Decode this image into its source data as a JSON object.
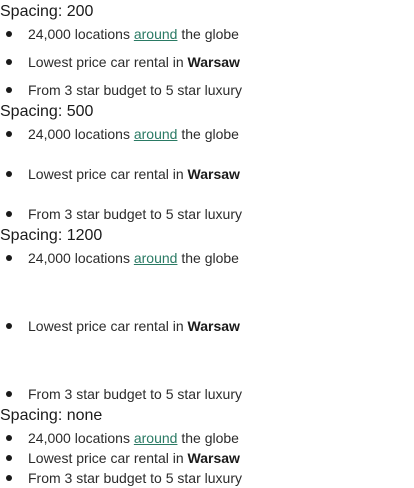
{
  "sections": [
    {
      "heading": "Spacing: 200",
      "items": [
        {
          "pre": "24,000 locations ",
          "link": "around",
          "post": " the globe"
        },
        {
          "pre": "Lowest price car rental in ",
          "bold": "Warsaw"
        },
        {
          "pre": "From 3 star budget to 5 star luxury"
        }
      ]
    },
    {
      "heading": "Spacing: 500",
      "items": [
        {
          "pre": "24,000 locations ",
          "link": "around",
          "post": " the globe"
        },
        {
          "pre": "Lowest price car rental in ",
          "bold": "Warsaw"
        },
        {
          "pre": "From 3 star budget to 5 star luxury"
        }
      ]
    },
    {
      "heading": "Spacing: 1200",
      "items": [
        {
          "pre": "24,000 locations ",
          "link": "around",
          "post": " the globe"
        },
        {
          "pre": "Lowest price car rental in ",
          "bold": "Warsaw"
        },
        {
          "pre": "From 3 star budget to 5 star luxury"
        }
      ]
    },
    {
      "heading": "Spacing: none",
      "items": [
        {
          "pre": "24,000 locations ",
          "link": "around",
          "post": " the globe"
        },
        {
          "pre": "Lowest price car rental in ",
          "bold": "Warsaw"
        },
        {
          "pre": "From 3 star budget to 5 star luxury"
        }
      ]
    }
  ],
  "colors": {
    "link": "#2a7a64",
    "text": "#2b2b2b",
    "heading": "#1a1a1a"
  }
}
